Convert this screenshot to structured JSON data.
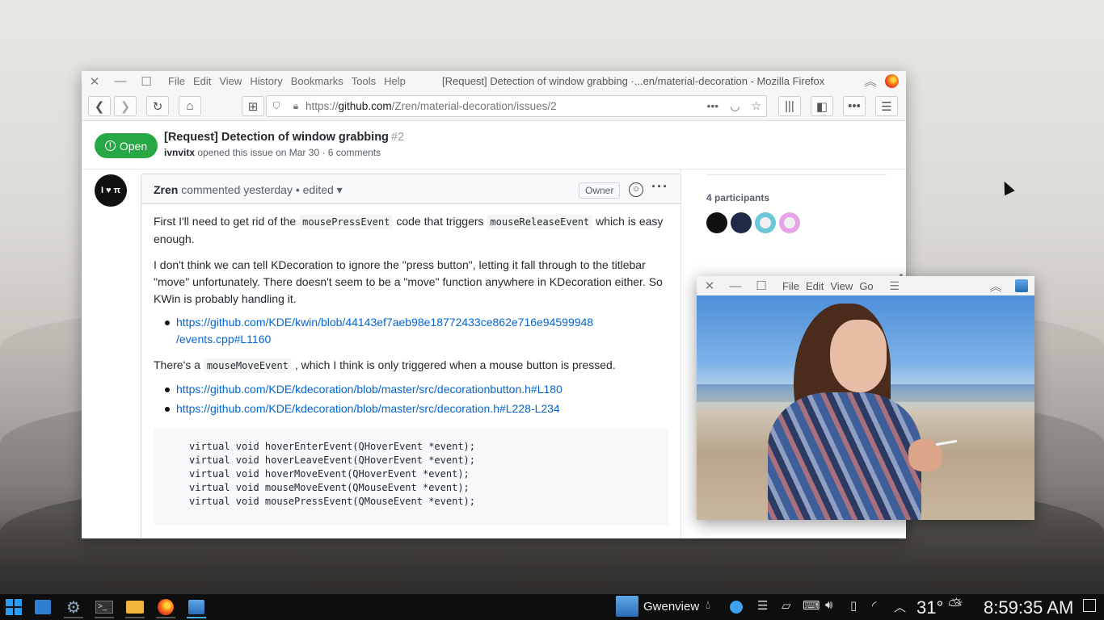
{
  "firefox": {
    "menu": [
      "File",
      "Edit",
      "View",
      "History",
      "Bookmarks",
      "Tools",
      "Help"
    ],
    "window_title": "[Request] Detection of window grabbing ·...en/material-decoration - Mozilla Firefox",
    "url_prefix": "https://",
    "url_host": "github.com",
    "url_path": "/Zren/material-decoration/issues/2"
  },
  "issue": {
    "status": "Open",
    "title": "[Request] Detection of window grabbing",
    "number": "#2",
    "author": "ivnvitx",
    "meta_rest": " opened this issue on Mar 30 · 6 comments"
  },
  "comment": {
    "avatar_text": "I ♥ π",
    "author": "Zren",
    "action": " commented yesterday • edited ▾",
    "role_badge": "Owner",
    "p1_a": "First I'll need to get rid of the ",
    "p1_code1": "mousePressEvent",
    "p1_b": " code that triggers ",
    "p1_code2": "mouseReleaseEvent",
    "p1_c": " which is easy enough.",
    "p2": "I don't think we can tell KDecoration to ignore the \"press button\", letting it fall through to the titlebar \"move\" unfortunately. There doesn't seem to be a \"move\" function anywhere in KDecoration either. So KWin is probably handling it.",
    "link1_line1": "https://github.com/KDE/kwin/blob/44143ef7aeb98e18772433ce862e716e94599948",
    "link1_line2": "/events.cpp#L1160",
    "p3_a": "There's a ",
    "p3_code": "mouseMoveEvent",
    "p3_b": " , which I think is only triggered when a mouse button is pressed.",
    "link2": "https://github.com/KDE/kdecoration/blob/master/src/decorationbutton.h#L180",
    "link3": "https://github.com/KDE/kdecoration/blob/master/src/decoration.h#L228-L234",
    "code_lines": "virtual void hoverEnterEvent(QHoverEvent *event);\nvirtual void hoverLeaveEvent(QHoverEvent *event);\nvirtual void hoverMoveEvent(QHoverEvent *event);\nvirtual void mouseMoveEvent(QMouseEvent *event);\nvirtual void mousePressEvent(QMouseEvent *event);"
  },
  "sidebar": {
    "participants_heading": "4 participants"
  },
  "gwenview": {
    "menu": [
      "File",
      "Edit",
      "View",
      "Go"
    ]
  },
  "taskbar": {
    "task_label": "Gwenview",
    "temperature": "31°",
    "clock": "8:59:35 AM"
  },
  "colors": {
    "accent": "#3daee9",
    "open_green": "#28a745",
    "link_blue": "#0366d6"
  }
}
